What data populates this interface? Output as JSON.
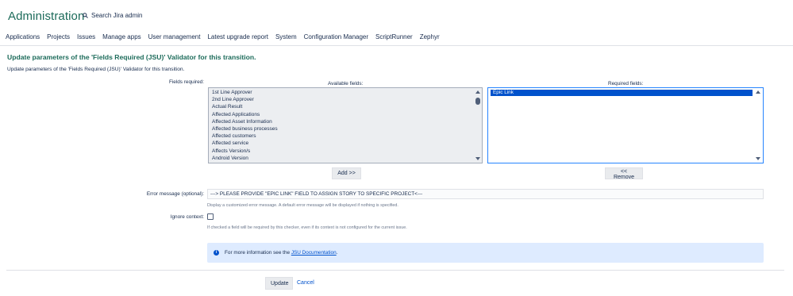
{
  "header": {
    "title": "Administration",
    "search_placeholder": "Search Jira admin"
  },
  "nav": {
    "items": [
      "Applications",
      "Projects",
      "Issues",
      "Manage apps",
      "User management",
      "Latest upgrade report",
      "System",
      "Configuration Manager",
      "ScriptRunner",
      "Zephyr"
    ]
  },
  "page": {
    "heading": "Update parameters of the 'Fields Required (JSU)' Validator for this transition.",
    "description": "Update parameters of the 'Fields Required (JSU)' Validator for this transition."
  },
  "form": {
    "fields_required_label": "Fields required:",
    "available_label": "Available fields:",
    "required_label": "Required fields:",
    "available_fields": [
      "1st Line Approver",
      "2nd Line Approver",
      "Actual Result",
      "Affected Applications",
      "Affected Asset Information",
      "Affected business processes",
      "Affected customers",
      "Affected service",
      "Affects Version/s",
      "Android Version"
    ],
    "required_fields": [
      "Epic Link"
    ],
    "add_button": "Add >>",
    "remove_button": "<< Remove",
    "error_label": "Error message (optional):",
    "error_value": "---> PLEASE PROVIDE \"EPIC LINK\" FIELD TO ASSIGN STORY TO SPECIFIC PROJECT<---",
    "error_hint": "Display a customized error message. A default error message will be displayed if nothing is specified.",
    "ignore_label": "Ignore context:",
    "ignore_hint": "If checked a field will be required by this checker, even if its context is not configured for the current issue.",
    "info_prefix": "For more information see the ",
    "info_link": "JSU Documentation",
    "info_suffix": "."
  },
  "actions": {
    "update": "Update",
    "cancel": "Cancel"
  }
}
